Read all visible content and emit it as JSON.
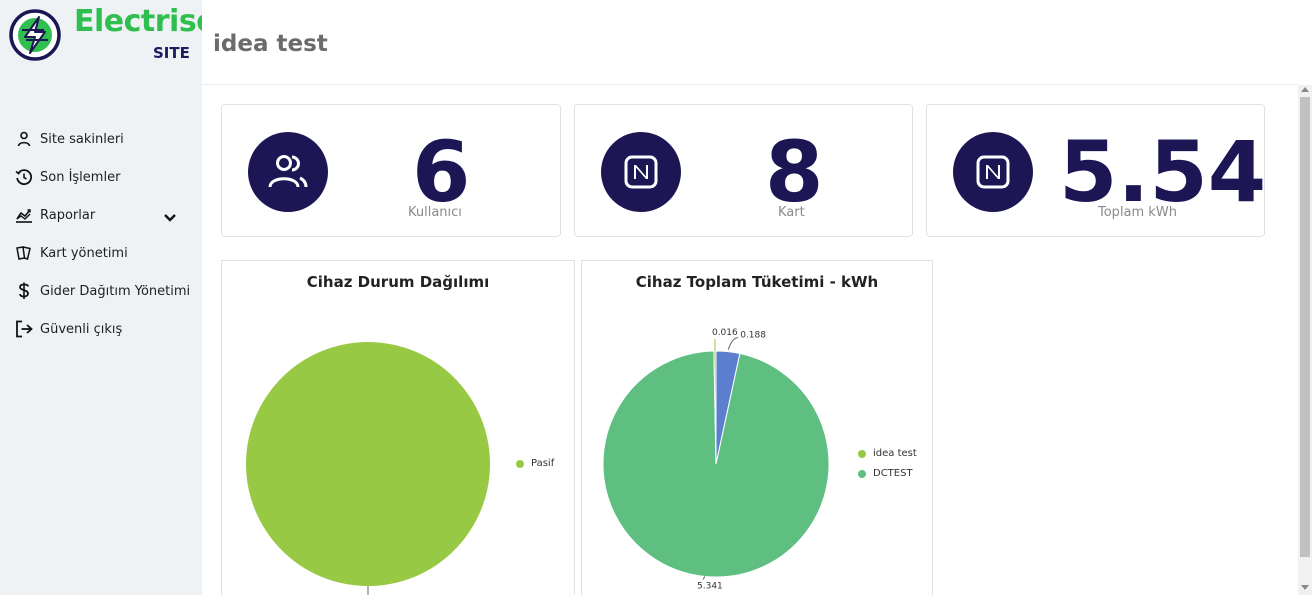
{
  "brand": {
    "name": "Electrise",
    "sub": "SITE",
    "colors": {
      "green": "#2fbf4e",
      "navy": "#1c1754"
    }
  },
  "header": {
    "title": "idea test"
  },
  "sidebar": {
    "items": [
      {
        "label": "Site sakinleri",
        "icon": "person-icon"
      },
      {
        "label": "Son İşlemler",
        "icon": "history-icon"
      },
      {
        "label": "Raporlar",
        "icon": "chart-icon",
        "expandable": true
      },
      {
        "label": "Kart yönetimi",
        "icon": "cards-icon"
      },
      {
        "label": "Gider Dağıtım Yönetimi",
        "icon": "dollar-icon"
      },
      {
        "label": "Güvenli çıkış",
        "icon": "logout-icon"
      }
    ]
  },
  "stats": [
    {
      "value": "6",
      "label": "Kullanıcı",
      "icon": "users-icon"
    },
    {
      "value": "8",
      "label": "Kart",
      "icon": "nfc-icon"
    },
    {
      "value": "5.54",
      "label": "Toplam kWh",
      "icon": "nfc-icon"
    }
  ],
  "chart_data": [
    {
      "type": "pie",
      "title": "Cihaz Durum Dağılımı",
      "categories": [
        "Pasif"
      ],
      "values": [
        1
      ],
      "colors": [
        "#97c944"
      ],
      "legend": "right"
    },
    {
      "type": "pie",
      "title": "Cihaz Toplam Tüketimi - kWh",
      "categories": [
        "idea test",
        "DCTEST",
        ""
      ],
      "values": [
        0.188,
        5.341,
        0.016
      ],
      "data_labels": [
        "0.188",
        "5.341",
        "0.016"
      ],
      "colors": [
        "#5b7fce",
        "#5fbf80",
        "#97c944"
      ],
      "legend_labels": [
        "idea test",
        "DCTEST"
      ],
      "legend_colors": [
        "#97c944",
        "#5fbf80"
      ],
      "legend": "right"
    }
  ]
}
